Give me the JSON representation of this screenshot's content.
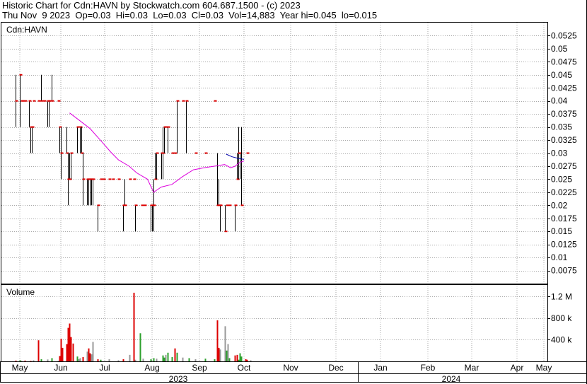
{
  "header": {
    "line1": "Historic Chart for Cdn:HAVN by Stockwatch.com 604.687.1500 - (c) 2023",
    "line2": "Thu Nov  9 2023  Op=0.03  Hi=0.03  Lo=0.03  Cl=0.03  Vol=14,883  Year hi=0.045  lo=0.015"
  },
  "price_panel": {
    "label": "Cdn:HAVN"
  },
  "volume_panel": {
    "label": "Volume"
  },
  "colors": {
    "background": "#ffffff",
    "grid": "#a8a8a8",
    "ohlc_bar": "#000000",
    "close_tick": "#dd0000",
    "ma_long": "#dd00dd",
    "ma_short": "#0000aa",
    "volume_up": "#2ca02c",
    "volume_down": "#dd0000",
    "volume_flat": "#999999"
  },
  "chart_data": {
    "type": "ohlc",
    "ticker": "Cdn:HAVN",
    "x_axis": {
      "month_labels": [
        "May",
        "Jun",
        "Jul",
        "Aug",
        "Sep",
        "Oct",
        "Nov",
        "Dec",
        "Jan",
        "Feb",
        "Mar",
        "Apr",
        "May"
      ],
      "year_labels": [
        "2023",
        "2024"
      ]
    },
    "price_axis": {
      "ylim": [
        0.005,
        0.055
      ],
      "tick_labels": [
        "0.0525",
        "0.05",
        "0.0475",
        "0.045",
        "0.0425",
        "0.04",
        "0.0375",
        "0.035",
        "0.0325",
        "0.03",
        "0.0275",
        "0.025",
        "0.0225",
        "0.02",
        "0.0175",
        "0.015",
        "0.0125",
        "0.01",
        "0.0075"
      ],
      "tick_values": [
        0.0525,
        0.05,
        0.0475,
        0.045,
        0.0425,
        0.04,
        0.0375,
        0.035,
        0.0325,
        0.03,
        0.0275,
        0.025,
        0.0225,
        0.02,
        0.0175,
        0.015,
        0.0125,
        0.01,
        0.0075
      ],
      "grid": true
    },
    "volume_axis": {
      "ylim": [
        0,
        1400000
      ],
      "tick_labels": [
        "1.2 M",
        "800 k",
        "400 k"
      ],
      "tick_values": [
        1200000,
        800000,
        400000
      ],
      "grid": true
    },
    "ohlc": [
      {
        "d": "2023-04-28",
        "h": 0.045,
        "l": 0.035,
        "c": 0.04
      },
      {
        "d": "2023-05-01",
        "h": 0.045,
        "l": 0.035,
        "c": 0.045
      },
      {
        "d": "2023-05-02",
        "h": 0.04,
        "l": 0.04,
        "c": 0.04
      },
      {
        "d": "2023-05-03",
        "h": 0.04,
        "l": 0.04,
        "c": 0.04
      },
      {
        "d": "2023-05-05",
        "h": 0.04,
        "l": 0.04,
        "c": 0.04
      },
      {
        "d": "2023-05-08",
        "h": 0.04,
        "l": 0.035,
        "c": 0.04
      },
      {
        "d": "2023-05-09",
        "h": 0.035,
        "l": 0.03,
        "c": 0.035
      },
      {
        "d": "2023-05-10",
        "h": 0.035,
        "l": 0.03,
        "c": 0.035
      },
      {
        "d": "2023-05-11",
        "h": 0.04,
        "l": 0.04,
        "c": 0.04
      },
      {
        "d": "2023-05-15",
        "h": 0.04,
        "l": 0.04,
        "c": 0.04
      },
      {
        "d": "2023-05-17",
        "h": 0.045,
        "l": 0.04,
        "c": 0.04
      },
      {
        "d": "2023-05-19",
        "h": 0.04,
        "l": 0.04,
        "c": 0.04
      },
      {
        "d": "2023-05-22",
        "h": 0.04,
        "l": 0.035,
        "c": 0.04
      },
      {
        "d": "2023-05-23",
        "h": 0.04,
        "l": 0.035,
        "c": 0.04
      },
      {
        "d": "2023-05-25",
        "h": 0.045,
        "l": 0.04,
        "c": 0.04
      },
      {
        "d": "2023-05-30",
        "h": 0.04,
        "l": 0.04,
        "c": 0.04
      },
      {
        "d": "2023-05-31",
        "h": 0.035,
        "l": 0.03,
        "c": 0.035
      },
      {
        "d": "2023-06-01",
        "h": 0.035,
        "l": 0.025,
        "c": 0.03
      },
      {
        "d": "2023-06-05",
        "h": 0.035,
        "l": 0.03,
        "c": 0.03
      },
      {
        "d": "2023-06-06",
        "h": 0.03,
        "l": 0.02,
        "c": 0.025
      },
      {
        "d": "2023-06-07",
        "h": 0.03,
        "l": 0.025,
        "c": 0.025
      },
      {
        "d": "2023-06-08",
        "h": 0.03,
        "l": 0.025,
        "c": 0.03
      },
      {
        "d": "2023-06-12",
        "h": 0.035,
        "l": 0.03,
        "c": 0.035
      },
      {
        "d": "2023-06-14",
        "h": 0.035,
        "l": 0.03,
        "c": 0.035
      },
      {
        "d": "2023-06-15",
        "h": 0.035,
        "l": 0.03,
        "c": 0.03
      },
      {
        "d": "2023-06-16",
        "h": 0.03,
        "l": 0.02,
        "c": 0.025
      },
      {
        "d": "2023-06-19",
        "h": 0.025,
        "l": 0.02,
        "c": 0.025
      },
      {
        "d": "2023-06-20",
        "h": 0.025,
        "l": 0.02,
        "c": 0.025
      },
      {
        "d": "2023-06-21",
        "h": 0.025,
        "l": 0.02,
        "c": 0.025
      },
      {
        "d": "2023-06-22",
        "h": 0.025,
        "l": 0.02,
        "c": 0.025
      },
      {
        "d": "2023-06-23",
        "h": 0.025,
        "l": 0.02,
        "c": 0.025
      },
      {
        "d": "2023-06-26",
        "h": 0.02,
        "l": 0.015,
        "c": 0.02
      },
      {
        "d": "2023-06-28",
        "h": 0.025,
        "l": 0.025,
        "c": 0.025
      },
      {
        "d": "2023-06-30",
        "h": 0.025,
        "l": 0.025,
        "c": 0.025
      },
      {
        "d": "2023-07-04",
        "h": 0.025,
        "l": 0.025,
        "c": 0.025
      },
      {
        "d": "2023-07-06",
        "h": 0.025,
        "l": 0.025,
        "c": 0.025
      },
      {
        "d": "2023-07-10",
        "h": 0.025,
        "l": 0.025,
        "c": 0.025
      },
      {
        "d": "2023-07-13",
        "h": 0.02,
        "l": 0.015,
        "c": 0.02
      },
      {
        "d": "2023-07-14",
        "h": 0.025,
        "l": 0.02,
        "c": 0.02
      },
      {
        "d": "2023-07-17",
        "h": 0.025,
        "l": 0.025,
        "c": 0.025
      },
      {
        "d": "2023-07-20",
        "h": 0.025,
        "l": 0.025,
        "c": 0.025
      },
      {
        "d": "2023-07-21",
        "h": 0.02,
        "l": 0.015,
        "c": 0.02
      },
      {
        "d": "2023-07-25",
        "h": 0.02,
        "l": 0.02,
        "c": 0.02
      },
      {
        "d": "2023-07-27",
        "h": 0.02,
        "l": 0.02,
        "c": 0.02
      },
      {
        "d": "2023-07-31",
        "h": 0.02,
        "l": 0.015,
        "c": 0.02
      },
      {
        "d": "2023-08-01",
        "h": 0.02,
        "l": 0.015,
        "c": 0.02
      },
      {
        "d": "2023-08-02",
        "h": 0.025,
        "l": 0.015,
        "c": 0.02
      },
      {
        "d": "2023-08-03",
        "h": 0.03,
        "l": 0.025,
        "c": 0.025
      },
      {
        "d": "2023-08-04",
        "h": 0.03,
        "l": 0.025,
        "c": 0.03
      },
      {
        "d": "2023-08-07",
        "h": 0.03,
        "l": 0.025,
        "c": 0.03
      },
      {
        "d": "2023-08-08",
        "h": 0.035,
        "l": 0.025,
        "c": 0.03
      },
      {
        "d": "2023-08-09",
        "h": 0.035,
        "l": 0.03,
        "c": 0.035
      },
      {
        "d": "2023-08-10",
        "h": 0.035,
        "l": 0.035,
        "c": 0.035
      },
      {
        "d": "2023-08-11",
        "h": 0.035,
        "l": 0.03,
        "c": 0.035
      },
      {
        "d": "2023-08-14",
        "h": 0.03,
        "l": 0.03,
        "c": 0.03
      },
      {
        "d": "2023-08-16",
        "h": 0.03,
        "l": 0.03,
        "c": 0.03
      },
      {
        "d": "2023-08-17",
        "h": 0.04,
        "l": 0.03,
        "c": 0.04
      },
      {
        "d": "2023-08-21",
        "h": 0.04,
        "l": 0.04,
        "c": 0.04
      },
      {
        "d": "2023-08-23",
        "h": 0.04,
        "l": 0.03,
        "c": 0.04
      },
      {
        "d": "2023-08-29",
        "h": 0.03,
        "l": 0.03,
        "c": 0.03
      },
      {
        "d": "2023-09-05",
        "h": 0.03,
        "l": 0.03,
        "c": 0.03
      },
      {
        "d": "2023-09-11",
        "h": 0.04,
        "l": 0.04,
        "c": 0.04
      },
      {
        "d": "2023-09-13",
        "h": 0.03,
        "l": 0.02,
        "c": 0.02
      },
      {
        "d": "2023-09-14",
        "h": 0.025,
        "l": 0.02,
        "c": 0.02
      },
      {
        "d": "2023-09-15",
        "h": 0.02,
        "l": 0.015,
        "c": 0.02
      },
      {
        "d": "2023-09-18",
        "h": 0.02,
        "l": 0.015,
        "c": 0.015
      },
      {
        "d": "2023-09-19",
        "h": 0.02,
        "l": 0.02,
        "c": 0.02
      },
      {
        "d": "2023-09-21",
        "h": 0.02,
        "l": 0.02,
        "c": 0.02
      },
      {
        "d": "2023-09-25",
        "h": 0.02,
        "l": 0.015,
        "c": 0.02
      },
      {
        "d": "2023-09-26",
        "h": 0.03,
        "l": 0.025,
        "c": 0.025
      },
      {
        "d": "2023-09-27",
        "h": 0.035,
        "l": 0.025,
        "c": 0.03
      },
      {
        "d": "2023-09-28",
        "h": 0.03,
        "l": 0.025,
        "c": 0.03
      },
      {
        "d": "2023-09-29",
        "h": 0.035,
        "l": 0.02,
        "c": 0.02
      },
      {
        "d": "2023-10-03",
        "h": 0.03,
        "l": 0.03,
        "c": 0.03
      }
    ],
    "volume": [
      {
        "d": "2023-04-28",
        "v": 15000,
        "dir": "down"
      },
      {
        "d": "2023-05-01",
        "v": 20000,
        "dir": "up"
      },
      {
        "d": "2023-05-02",
        "v": 10000,
        "dir": "flat"
      },
      {
        "d": "2023-05-05",
        "v": 15000,
        "dir": "down"
      },
      {
        "d": "2023-05-09",
        "v": 10000,
        "dir": "down"
      },
      {
        "d": "2023-05-11",
        "v": 20000,
        "dir": "flat"
      },
      {
        "d": "2023-05-15",
        "v": 390000,
        "dir": "down"
      },
      {
        "d": "2023-05-17",
        "v": 40000,
        "dir": "up"
      },
      {
        "d": "2023-05-22",
        "v": 35000,
        "dir": "flat"
      },
      {
        "d": "2023-05-25",
        "v": 60000,
        "dir": "up"
      },
      {
        "d": "2023-05-30",
        "v": 10000,
        "dir": "flat"
      },
      {
        "d": "2023-05-31",
        "v": 100000,
        "dir": "down"
      },
      {
        "d": "2023-06-01",
        "v": 420000,
        "dir": "down"
      },
      {
        "d": "2023-06-02",
        "v": 250000,
        "dir": "down"
      },
      {
        "d": "2023-06-05",
        "v": 320000,
        "dir": "down"
      },
      {
        "d": "2023-06-06",
        "v": 620000,
        "dir": "down"
      },
      {
        "d": "2023-06-07",
        "v": 700000,
        "dir": "down"
      },
      {
        "d": "2023-06-08",
        "v": 450000,
        "dir": "down"
      },
      {
        "d": "2023-06-09",
        "v": 330000,
        "dir": "down"
      },
      {
        "d": "2023-06-12",
        "v": 90000,
        "dir": "up"
      },
      {
        "d": "2023-06-13",
        "v": 40000,
        "dir": "flat"
      },
      {
        "d": "2023-06-14",
        "v": 60000,
        "dir": "flat"
      },
      {
        "d": "2023-06-16",
        "v": 80000,
        "dir": "down"
      },
      {
        "d": "2023-06-19",
        "v": 180000,
        "dir": "flat"
      },
      {
        "d": "2023-06-20",
        "v": 240000,
        "dir": "down"
      },
      {
        "d": "2023-06-21",
        "v": 150000,
        "dir": "down"
      },
      {
        "d": "2023-06-22",
        "v": 130000,
        "dir": "flat"
      },
      {
        "d": "2023-06-23",
        "v": 360000,
        "dir": "flat"
      },
      {
        "d": "2023-06-26",
        "v": 40000,
        "dir": "down"
      },
      {
        "d": "2023-06-28",
        "v": 30000,
        "dir": "up"
      },
      {
        "d": "2023-07-04",
        "v": 40000,
        "dir": "flat"
      },
      {
        "d": "2023-07-10",
        "v": 20000,
        "dir": "flat"
      },
      {
        "d": "2023-07-13",
        "v": 40000,
        "dir": "down"
      },
      {
        "d": "2023-07-17",
        "v": 120000,
        "dir": "flat"
      },
      {
        "d": "2023-07-20",
        "v": 1270000,
        "dir": "down"
      },
      {
        "d": "2023-07-21",
        "v": 30000,
        "dir": "flat"
      },
      {
        "d": "2023-07-24",
        "v": 520000,
        "dir": "up"
      },
      {
        "d": "2023-07-26",
        "v": 50000,
        "dir": "flat"
      },
      {
        "d": "2023-07-31",
        "v": 40000,
        "dir": "up"
      },
      {
        "d": "2023-08-02",
        "v": 60000,
        "dir": "up"
      },
      {
        "d": "2023-08-04",
        "v": 50000,
        "dir": "flat"
      },
      {
        "d": "2023-08-08",
        "v": 110000,
        "dir": "up"
      },
      {
        "d": "2023-08-09",
        "v": 70000,
        "dir": "up"
      },
      {
        "d": "2023-08-10",
        "v": 120000,
        "dir": "flat"
      },
      {
        "d": "2023-08-11",
        "v": 160000,
        "dir": "up"
      },
      {
        "d": "2023-08-14",
        "v": 80000,
        "dir": "up"
      },
      {
        "d": "2023-08-16",
        "v": 240000,
        "dir": "down"
      },
      {
        "d": "2023-08-17",
        "v": 160000,
        "dir": "up"
      },
      {
        "d": "2023-08-21",
        "v": 70000,
        "dir": "flat"
      },
      {
        "d": "2023-08-25",
        "v": 60000,
        "dir": "up"
      },
      {
        "d": "2023-08-29",
        "v": 40000,
        "dir": "flat"
      },
      {
        "d": "2023-09-05",
        "v": 50000,
        "dir": "up"
      },
      {
        "d": "2023-09-11",
        "v": 40000,
        "dir": "up"
      },
      {
        "d": "2023-09-13",
        "v": 760000,
        "dir": "down"
      },
      {
        "d": "2023-09-14",
        "v": 250000,
        "dir": "down"
      },
      {
        "d": "2023-09-15",
        "v": 220000,
        "dir": "flat"
      },
      {
        "d": "2023-09-18",
        "v": 650000,
        "dir": "flat"
      },
      {
        "d": "2023-09-19",
        "v": 200000,
        "dir": "up"
      },
      {
        "d": "2023-09-20",
        "v": 320000,
        "dir": "flat"
      },
      {
        "d": "2023-09-21",
        "v": 60000,
        "dir": "up"
      },
      {
        "d": "2023-09-25",
        "v": 110000,
        "dir": "down"
      },
      {
        "d": "2023-09-26",
        "v": 120000,
        "dir": "down"
      },
      {
        "d": "2023-09-27",
        "v": 30000,
        "dir": "up"
      },
      {
        "d": "2023-09-28",
        "v": 150000,
        "dir": "up"
      },
      {
        "d": "2023-09-29",
        "v": 90000,
        "dir": "up"
      },
      {
        "d": "2023-10-02",
        "v": 40000,
        "dir": "down"
      },
      {
        "d": "2023-10-03",
        "v": 30000,
        "dir": "down"
      },
      {
        "d": "2023-10-05",
        "v": 20000,
        "dir": "flat"
      }
    ],
    "moving_average_long": [
      {
        "d": "2023-06-07",
        "v": 0.0377
      },
      {
        "d": "2023-06-14",
        "v": 0.0362
      },
      {
        "d": "2023-06-21",
        "v": 0.0347
      },
      {
        "d": "2023-06-28",
        "v": 0.0325
      },
      {
        "d": "2023-07-05",
        "v": 0.0302
      },
      {
        "d": "2023-07-10",
        "v": 0.0287
      },
      {
        "d": "2023-07-17",
        "v": 0.0275
      },
      {
        "d": "2023-07-22",
        "v": 0.0262
      },
      {
        "d": "2023-07-29",
        "v": 0.025
      },
      {
        "d": "2023-08-02",
        "v": 0.0225
      },
      {
        "d": "2023-08-07",
        "v": 0.0235
      },
      {
        "d": "2023-08-14",
        "v": 0.024
      },
      {
        "d": "2023-08-21",
        "v": 0.0255
      },
      {
        "d": "2023-08-28",
        "v": 0.0268
      },
      {
        "d": "2023-09-04",
        "v": 0.0272
      },
      {
        "d": "2023-09-11",
        "v": 0.0275
      },
      {
        "d": "2023-09-18",
        "v": 0.0278
      },
      {
        "d": "2023-09-22",
        "v": 0.0272
      },
      {
        "d": "2023-09-25",
        "v": 0.0275
      },
      {
        "d": "2023-09-28",
        "v": 0.0282
      },
      {
        "d": "2023-10-01",
        "v": 0.0285
      }
    ],
    "moving_average_short": [
      {
        "d": "2023-09-19",
        "v": 0.0298
      },
      {
        "d": "2023-09-23",
        "v": 0.0293
      },
      {
        "d": "2023-09-27",
        "v": 0.029
      },
      {
        "d": "2023-10-01",
        "v": 0.0288
      }
    ]
  }
}
